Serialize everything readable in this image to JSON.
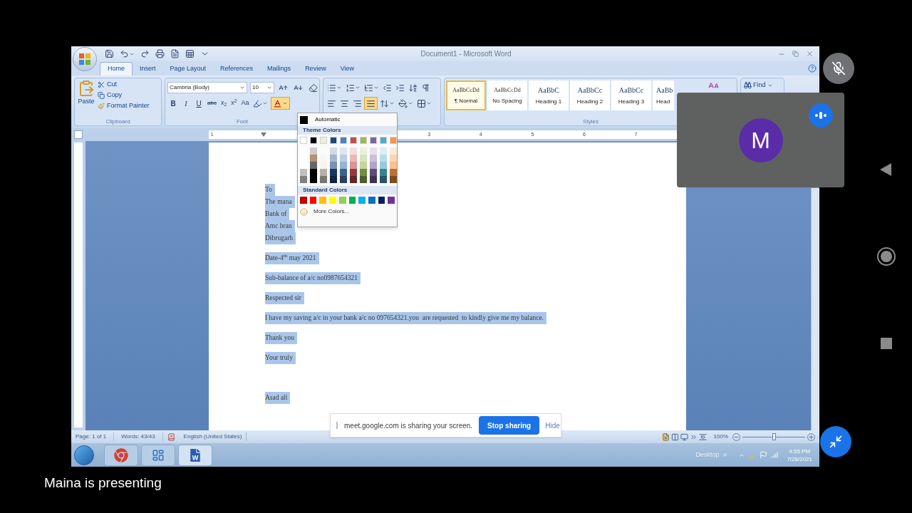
{
  "window": {
    "title": "Document1 - Microsoft Word"
  },
  "tabs": [
    {
      "label": "Home",
      "selected": true
    },
    {
      "label": "Insert",
      "selected": false
    },
    {
      "label": "Page Layout",
      "selected": false
    },
    {
      "label": "References",
      "selected": false
    },
    {
      "label": "Mailings",
      "selected": false
    },
    {
      "label": "Review",
      "selected": false
    },
    {
      "label": "View",
      "selected": false
    }
  ],
  "clipboard": {
    "label": "Clipboard",
    "paste": "Paste",
    "cut": "Cut",
    "copy": "Copy",
    "format_painter": "Format Painter"
  },
  "font": {
    "label": "Font",
    "family": "Cambria (Body)",
    "size": "10",
    "bold": "B",
    "italic": "I",
    "underline": "U",
    "strikethrough": "abc",
    "subscript": "x$_{2}$",
    "superscript": "x$^{2}$",
    "change_case": "Aa"
  },
  "styles": {
    "label": "Styles",
    "items": [
      {
        "preview": "AaBbCcDd",
        "name": "¶ Normal",
        "selected": true
      },
      {
        "preview": "AaBbCcDd",
        "name": "No Spacing",
        "selected": false
      },
      {
        "preview": "AaBbC",
        "name": "Heading 1",
        "selected": false
      },
      {
        "preview": "AaBbCc",
        "name": "Heading 2",
        "selected": false
      },
      {
        "preview": "AaBbCc",
        "name": "Heading 3",
        "selected": false
      },
      {
        "preview": "AaBb",
        "name": "Head",
        "selected": false
      }
    ]
  },
  "editing": {
    "find": "Find"
  },
  "ruler": {
    "left_mark": "1",
    "marks": [
      "3",
      "4",
      "5",
      "6",
      "7"
    ]
  },
  "font_color_menu": {
    "automatic": "Automatic",
    "theme_heading": "Theme Colors",
    "theme_colors": [
      {
        "color": "#ffffff"
      },
      {
        "color": "#000000"
      },
      {
        "color": "#eeece1"
      },
      {
        "color": "#1f497d"
      },
      {
        "color": "#4f81bd"
      },
      {
        "color": "#c0504d"
      },
      {
        "color": "#9bbb59"
      },
      {
        "color": "#8064a2"
      },
      {
        "color": "#4bacc6"
      },
      {
        "color": "#f79646"
      }
    ],
    "standard_heading": "Standard Colors",
    "standard_colors": [
      {
        "color": "#c00000"
      },
      {
        "color": "#ff0000"
      },
      {
        "color": "#ffc000"
      },
      {
        "color": "#ffff00"
      },
      {
        "color": "#92d050"
      },
      {
        "color": "#00b050"
      },
      {
        "color": "#00b0f0"
      },
      {
        "color": "#0070c0"
      },
      {
        "color": "#002060"
      },
      {
        "color": "#7030a0"
      }
    ],
    "more": "More Colors..."
  },
  "document": {
    "lines": [
      {
        "kind": "address",
        "text": "To"
      },
      {
        "kind": "address",
        "text": "The mana"
      },
      {
        "kind": "address",
        "text": "Bank of"
      },
      {
        "kind": "address",
        "text": "Amc bran"
      },
      {
        "kind": "address",
        "text": "Dibrugarh"
      },
      {
        "kind": "paragraph",
        "text": "Date-4$^{th}$ may 2021"
      },
      {
        "kind": "paragraph",
        "text": "Sub-balance of a/c no0987654321"
      },
      {
        "kind": "paragraph",
        "text": "Respected sir"
      },
      {
        "kind": "paragraph",
        "text": "I have my saving a/c in your bank a/c no 097654321.you  are requested  to kindly give me my balance."
      },
      {
        "kind": "paragraph",
        "text": "Thank you"
      },
      {
        "kind": "paragraph",
        "text": "Your truly"
      },
      {
        "kind": "signature",
        "text": "Asad ali"
      }
    ]
  },
  "status_bar": {
    "page": "Page: 1 of 1",
    "words": "Words: 43/43",
    "language": "English (United States)",
    "zoom": "100%",
    "zoom_slider": {
      "level": 0.5
    }
  },
  "taskbar": {
    "desktop": "Desktop",
    "time": "4:55 PM",
    "date": "7/28/2021"
  },
  "share_bar": {
    "message": "meet.google.com is sharing your screen.",
    "stop": "Stop sharing",
    "hide": "Hide"
  },
  "meet": {
    "presenter_caption": "Maina is presenting",
    "avatar_letter": "M"
  }
}
